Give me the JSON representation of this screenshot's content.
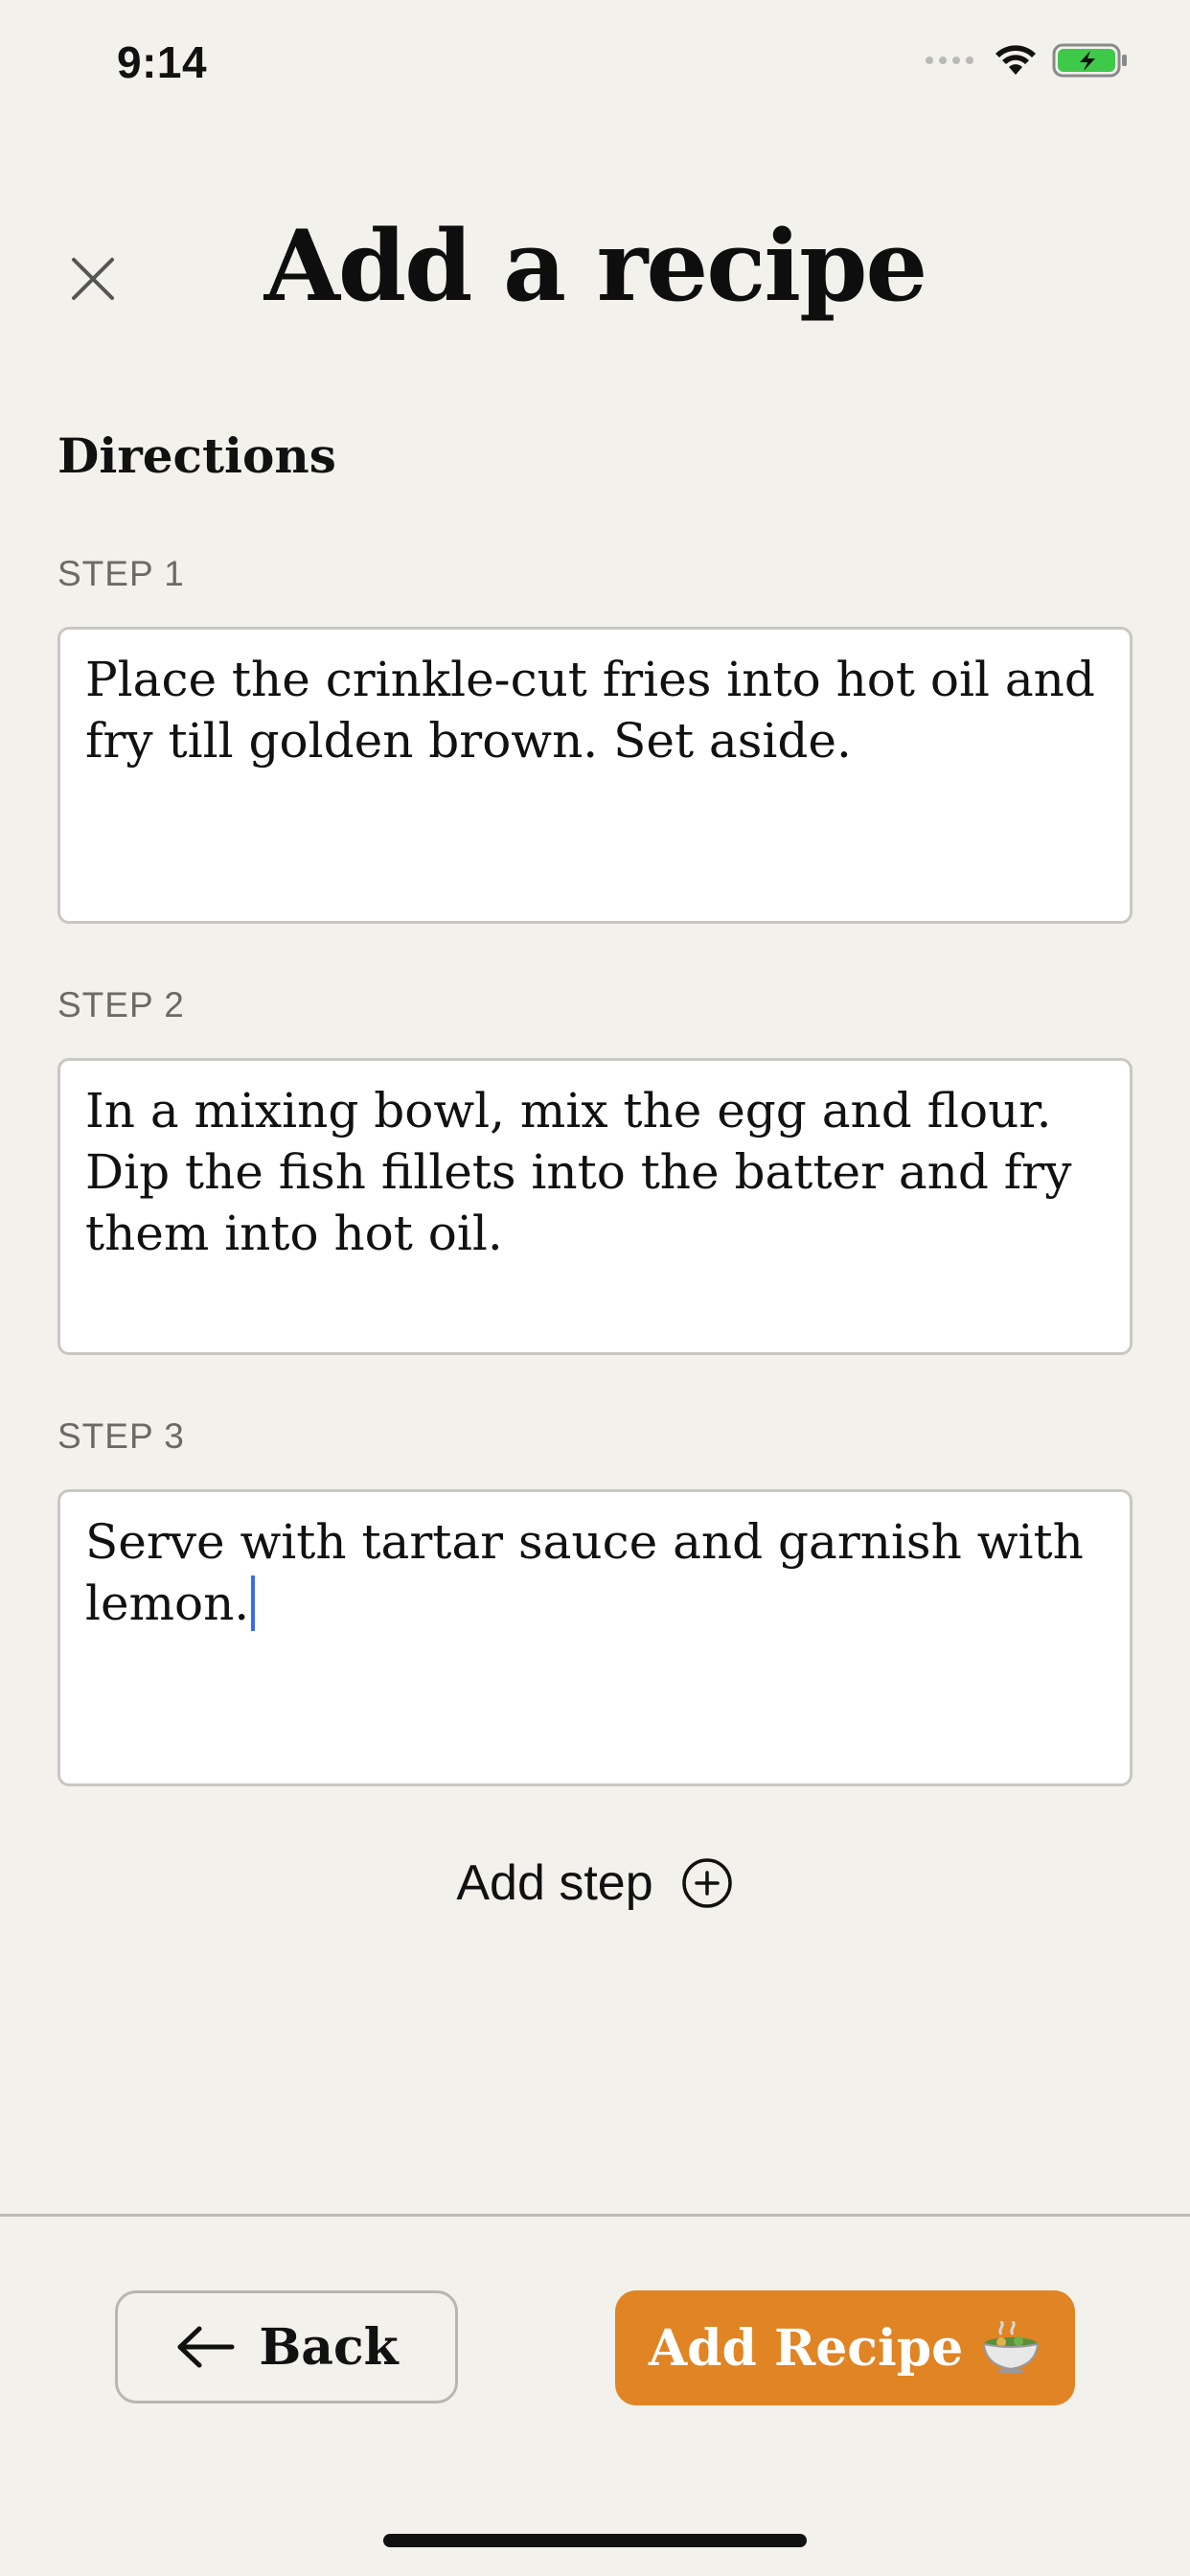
{
  "status_bar": {
    "time": "9:14",
    "icons": [
      "cellular-signal-icon",
      "wifi-icon",
      "battery-charging-icon"
    ],
    "battery_color": "#3ec94a"
  },
  "header": {
    "close_icon": "close-icon",
    "title": "Add a recipe"
  },
  "section": {
    "title": "Directions"
  },
  "steps": [
    {
      "label": "STEP 1",
      "text": "Place the crinkle-cut fries into hot oil and fry till golden brown. Set aside."
    },
    {
      "label": "STEP 2",
      "text": "In a mixing bowl, mix the egg and flour. Dip the fish fillets into the batter and fry them into hot oil."
    },
    {
      "label": "STEP 3",
      "text": "Serve with tartar sauce and garnish with lemon."
    }
  ],
  "add_step": {
    "label": "Add step",
    "icon": "plus-circle-icon"
  },
  "footer": {
    "back_label": "Back",
    "back_icon": "arrow-left-icon",
    "submit_label": "Add Recipe",
    "submit_icon": "food-bowl-icon",
    "accent_color": "#e08424"
  }
}
